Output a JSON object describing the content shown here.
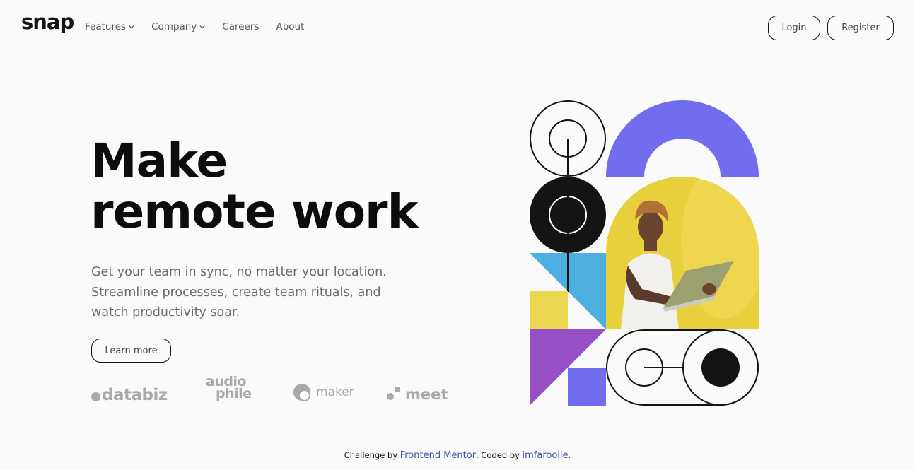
{
  "header": {
    "logo": "snap",
    "nav": [
      {
        "label": "Features",
        "has_dropdown": true
      },
      {
        "label": "Company",
        "has_dropdown": true
      },
      {
        "label": "Careers",
        "has_dropdown": false
      },
      {
        "label": "About",
        "has_dropdown": false
      }
    ],
    "login_label": "Login",
    "register_label": "Register"
  },
  "hero": {
    "title_line1": "Make",
    "title_line2": "remote work",
    "description": "Get your team in sync, no matter your location. Streamline processes, create team rituals, and watch productivity soar.",
    "cta_label": "Learn more"
  },
  "clients": {
    "databiz": "databiz",
    "audiophile_top": "audio",
    "audiophile_bottom": "phile",
    "maker": "maker",
    "meet": "meet"
  },
  "illustration": {
    "colors": {
      "purple": "#726cee",
      "yellow": "#ecd54f",
      "blue": "#4cafdf",
      "violet": "#9450c4",
      "black": "#141414"
    },
    "photo_icon": "person-with-laptop-photo"
  },
  "footer": {
    "prefix": "Challenge by ",
    "mentor_link": "Frontend Mentor",
    "middle": ". Coded by ",
    "author_link": "imfaroolle",
    "suffix": "."
  }
}
